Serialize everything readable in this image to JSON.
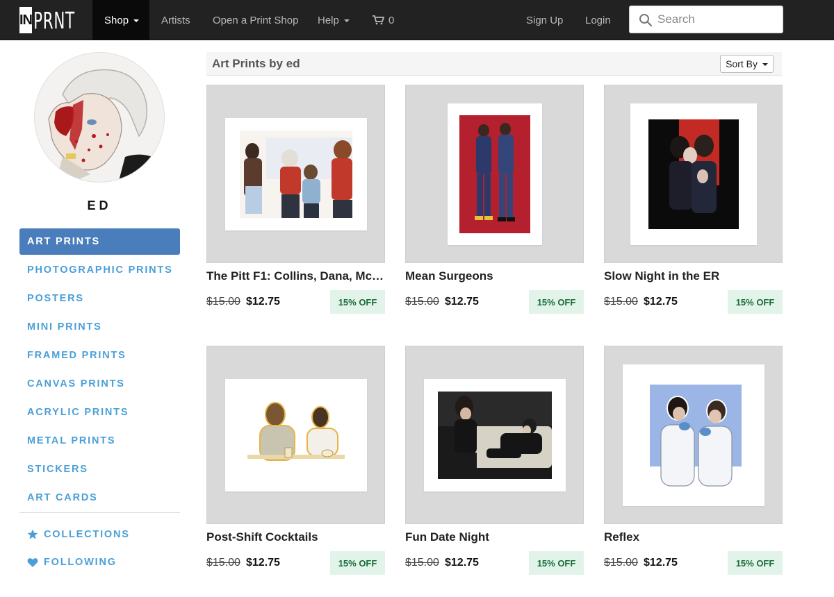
{
  "nav": {
    "logo_in": "IN",
    "logo_prnt": "PRNT",
    "shop": "Shop",
    "artists": "Artists",
    "open_shop": "Open a Print Shop",
    "help": "Help",
    "cart_count": "0",
    "sign_up": "Sign Up",
    "login": "Login",
    "search_placeholder": "Search"
  },
  "profile": {
    "username": "ED"
  },
  "sidebar": {
    "items": [
      {
        "label": "Art Prints",
        "active": true
      },
      {
        "label": "Photographic Prints"
      },
      {
        "label": "Posters"
      },
      {
        "label": "Mini Prints"
      },
      {
        "label": "Framed Prints"
      },
      {
        "label": "Canvas Prints"
      },
      {
        "label": "Acrylic Prints"
      },
      {
        "label": "Metal Prints"
      },
      {
        "label": "Stickers"
      },
      {
        "label": "Art Cards"
      }
    ],
    "collections": "Collections",
    "following": "Following"
  },
  "main": {
    "heading": "Art Prints by ed",
    "sort_label": "Sort By"
  },
  "products": [
    {
      "title": "The Pitt F1: Collins, Dana, Mck...",
      "old_price": "$15.00",
      "new_price": "$12.75",
      "badge": "15% OFF"
    },
    {
      "title": "Mean Surgeons",
      "old_price": "$15.00",
      "new_price": "$12.75",
      "badge": "15% OFF"
    },
    {
      "title": "Slow Night in the ER",
      "old_price": "$15.00",
      "new_price": "$12.75",
      "badge": "15% OFF"
    },
    {
      "title": "Post-Shift Cocktails",
      "old_price": "$15.00",
      "new_price": "$12.75",
      "badge": "15% OFF"
    },
    {
      "title": "Fun Date Night",
      "old_price": "$15.00",
      "new_price": "$12.75",
      "badge": "15% OFF"
    },
    {
      "title": "Reflex",
      "old_price": "$15.00",
      "new_price": "$12.75",
      "badge": "15% OFF"
    }
  ],
  "colors": {
    "nav_bg": "#222222",
    "accent_blue": "#4a9fd8",
    "active_item": "#4a7dbb",
    "discount_bg": "#e2f4ea",
    "discount_text": "#1b6b3a"
  }
}
